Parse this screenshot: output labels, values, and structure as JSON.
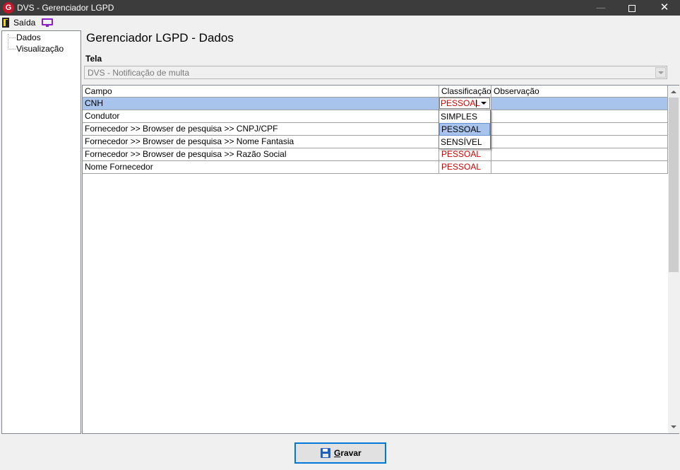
{
  "window": {
    "app_icon_letter": "G",
    "title": "DVS - Gerenciador LGPD",
    "minimize_glyph": "—",
    "close_glyph": "✕"
  },
  "menu": {
    "exit_label": "Saída",
    "exit_icon": "door-exit-icon",
    "monitor_icon": "monitor-icon"
  },
  "tree": {
    "items": [
      "Dados",
      "Visualização"
    ]
  },
  "page": {
    "title": "Gerenciador LGPD - Dados",
    "tela_label": "Tela",
    "tela_value": "DVS - Notificação de multa"
  },
  "grid": {
    "columns": [
      "Campo",
      "Classificação",
      "Observação"
    ],
    "rows": [
      {
        "campo": "CNH",
        "classificacao": "PESSOAL",
        "observacao": ""
      },
      {
        "campo": "Condutor",
        "classificacao": "",
        "observacao": ""
      },
      {
        "campo": "Fornecedor >> Browser de pesquisa >> CNPJ/CPF",
        "classificacao": "",
        "observacao": ""
      },
      {
        "campo": "Fornecedor >> Browser de pesquisa >> Nome Fantasia",
        "classificacao": "",
        "observacao": ""
      },
      {
        "campo": "Fornecedor >> Browser de pesquisa >> Razão Social",
        "classificacao": "PESSOAL",
        "observacao": ""
      },
      {
        "campo": "Nome Fornecedor",
        "classificacao": "PESSOAL",
        "observacao": ""
      }
    ],
    "selected_row": 0,
    "editor_value": "PESSOAL",
    "dropdown_options": [
      "SIMPLES",
      "PESSOAL",
      "SENSÍVEL"
    ],
    "dropdown_highlighted": "PESSOAL"
  },
  "footer": {
    "save_label": "Gravar",
    "save_icon": "floppy-disk-icon"
  },
  "colors": {
    "titlebar": "#3c3c3c",
    "classification_text": "#d00000",
    "selection": "#a8c4ec",
    "button_focus": "#0078d7"
  }
}
